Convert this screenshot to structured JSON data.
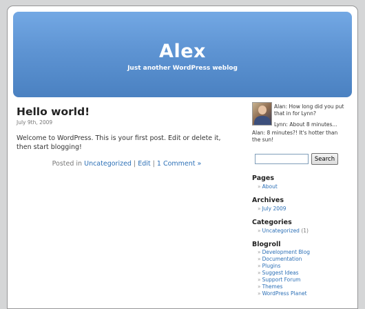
{
  "header": {
    "title": "Alex",
    "description": "Just another WordPress weblog"
  },
  "post": {
    "title": "Hello world!",
    "date": "July 9th, 2009",
    "body": "Welcome to WordPress. This is your first post. Edit or delete it, then start blogging!",
    "meta_prefix": "Posted in",
    "category": "Uncategorized",
    "separator": "|",
    "edit": "Edit",
    "comments": "1 Comment »"
  },
  "chat": {
    "line1": "Alan: How long did you put that in for Lynn?",
    "line2": "Lynn: About 8 minutes...",
    "line3": "Alan: 8 minutes?! It's hotter than the sun!"
  },
  "search": {
    "button_label": "Search",
    "value": ""
  },
  "sidebar": {
    "bullet": "»",
    "pages_title": "Pages",
    "pages": [
      "About"
    ],
    "archives_title": "Archives",
    "archives": [
      "July 2009"
    ],
    "categories_title": "Categories",
    "categories": [
      {
        "name": "Uncategorized",
        "count": "(1)"
      }
    ],
    "blogroll_title": "Blogroll",
    "blogroll": [
      "Development Blog",
      "Documentation",
      "Plugins",
      "Suggest Ideas",
      "Support Forum",
      "Themes",
      "WordPress Planet"
    ]
  },
  "colors": {
    "link": "#2b6fb6",
    "header_top": "#73a8e4",
    "header_bottom": "#4a81c1"
  }
}
